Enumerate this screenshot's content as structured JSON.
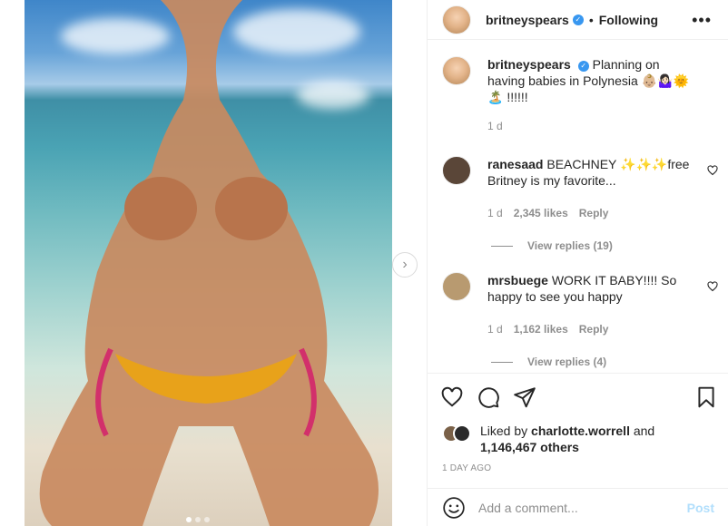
{
  "post": {
    "username": "britneyspears",
    "follow_status": "Following",
    "separator": "•",
    "more_label": "•••",
    "verified_glyph": "✓"
  },
  "caption": {
    "username": "britneyspears",
    "text": "Planning on having babies in Polynesia 👶🏼🤷🏻‍♀️🌞🏝️ !!!!!!",
    "time": "1 d"
  },
  "comments": [
    {
      "username": "ranesaad",
      "text": "BEACHNEY ✨✨✨free Britney is my favorite...",
      "time": "1 d",
      "likes": "2,345 likes",
      "reply_label": "Reply",
      "view_replies": "View replies (19)",
      "avatar_color": "#5a4638"
    },
    {
      "username": "mrsbuege",
      "text": "WORK IT BABY!!!! So happy to see you happy",
      "time": "1 d",
      "likes": "1,162 likes",
      "reply_label": "Reply",
      "view_replies": "View replies (4)",
      "avatar_color": "#b89a70"
    }
  ],
  "likes": {
    "prefix": "Liked by",
    "user": "charlotte.worrell",
    "conj": "and",
    "others": "1,146,467 others"
  },
  "timestamp": "1 DAY AGO",
  "comment_box": {
    "placeholder": "Add a comment...",
    "post_label": "Post"
  },
  "carousel": {
    "next_icon": "chevron-right-icon",
    "slide_index": 1,
    "slide_count": 3
  },
  "colors": {
    "text": "#262626",
    "muted": "#8e8e8e",
    "verified": "#3897f0",
    "post_disabled": "#b2dffc"
  }
}
